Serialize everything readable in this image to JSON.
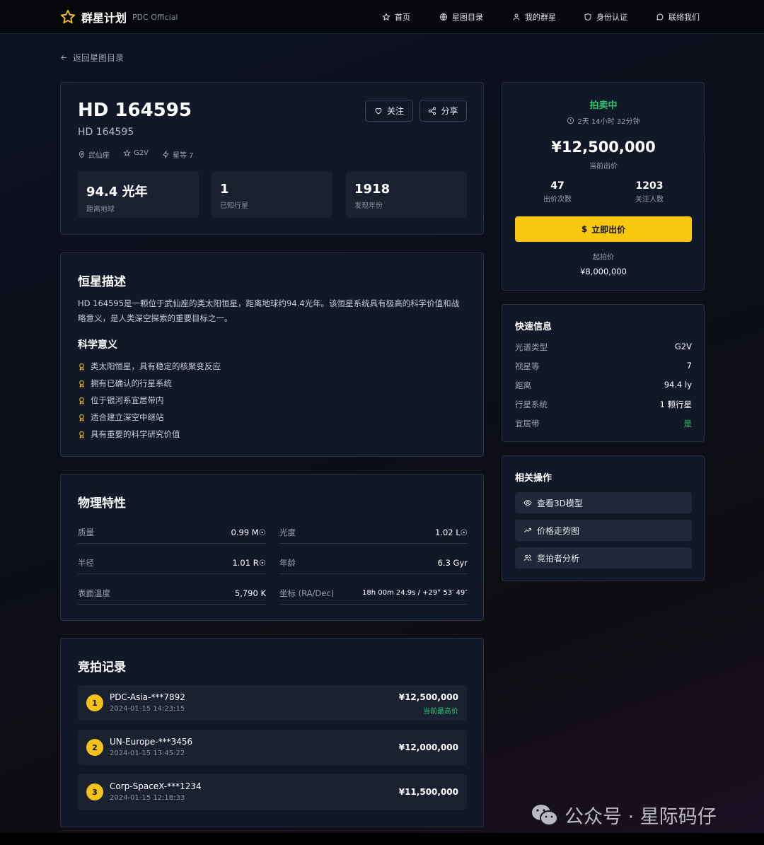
{
  "brand": {
    "name": "群星计划",
    "sub": "PDC Official",
    "logo_color": "#f5c518"
  },
  "nav": [
    {
      "label": "首页",
      "icon": "star-icon"
    },
    {
      "label": "星图目录",
      "icon": "globe-icon"
    },
    {
      "label": "我的群星",
      "icon": "user-icon"
    },
    {
      "label": "身份认证",
      "icon": "shield-icon"
    },
    {
      "label": "联络我们",
      "icon": "chat-icon"
    }
  ],
  "back_link": "返回星图目录",
  "star": {
    "title": "HD 164595",
    "subtitle": "HD 164595",
    "constellation": "武仙座",
    "spectral": "G2V",
    "magnitude": "星等 7",
    "follow_label": "关注",
    "share_label": "分享",
    "stats": [
      {
        "value": "94.4 光年",
        "label": "距离地球"
      },
      {
        "value": "1",
        "label": "已知行星"
      },
      {
        "value": "1918",
        "label": "发现年份"
      }
    ]
  },
  "description": {
    "title": "恒星描述",
    "text": "HD 164595是一颗位于武仙座的类太阳恒星，距离地球约94.4光年。该恒星系统具有极高的科学价值和战略意义，是人类深空探索的重要目标之一。",
    "sci_title": "科学意义",
    "items": [
      "类太阳恒星，具有稳定的核聚变反应",
      "拥有已确认的行星系统",
      "位于银河系宜居带内",
      "适合建立深空中继站",
      "具有重要的科学研究价值"
    ]
  },
  "physical": {
    "title": "物理特性",
    "rows": [
      {
        "k": "质量",
        "v": "0.99 M☉"
      },
      {
        "k": "光度",
        "v": "1.02 L☉"
      },
      {
        "k": "半径",
        "v": "1.01 R☉"
      },
      {
        "k": "年龄",
        "v": "6.3 Gyr"
      },
      {
        "k": "表面温度",
        "v": "5,790 K"
      },
      {
        "k": "坐标 (RA/Dec)",
        "v": "18h 00m 24.9s / +29° 53′ 49″"
      }
    ]
  },
  "bids": {
    "title": "竞拍记录",
    "list": [
      {
        "rank": "1",
        "name": "PDC-Asia-***7892",
        "time": "2024-01-15 14:23:15",
        "amount": "¥12,500,000",
        "note": "当前最高价"
      },
      {
        "rank": "2",
        "name": "UN-Europe-***3456",
        "time": "2024-01-15 13:45:22",
        "amount": "¥12,000,000",
        "note": ""
      },
      {
        "rank": "3",
        "name": "Corp-SpaceX-***1234",
        "time": "2024-01-15 12:18:33",
        "amount": "¥11,500,000",
        "note": ""
      }
    ]
  },
  "auction": {
    "status": "拍卖中",
    "countdown": "2天 14小时 32分钟",
    "price": "¥12,500,000",
    "price_label": "当前出价",
    "bid_count": "47",
    "bid_count_label": "出价次数",
    "followers": "1203",
    "followers_label": "关注人数",
    "bid_button": "立即出价",
    "start_label": "起拍价",
    "start_price": "¥8,000,000",
    "accent": "#f8c70e",
    "status_color": "#2fc36b"
  },
  "quick": {
    "title": "快速信息",
    "rows": [
      {
        "k": "光谱类型",
        "v": "G2V"
      },
      {
        "k": "视星等",
        "v": "7"
      },
      {
        "k": "距离",
        "v": "94.4 ly"
      },
      {
        "k": "行星系统",
        "v": "1 颗行星"
      },
      {
        "k": "宜居带",
        "v": "是"
      }
    ]
  },
  "actions": {
    "title": "相关操作",
    "items": [
      {
        "label": "查看3D模型",
        "icon": "eye-icon"
      },
      {
        "label": "价格走势图",
        "icon": "trend-icon"
      },
      {
        "label": "竞拍者分析",
        "icon": "users-icon"
      }
    ]
  },
  "watermark": "公众号 · 星际码仔"
}
